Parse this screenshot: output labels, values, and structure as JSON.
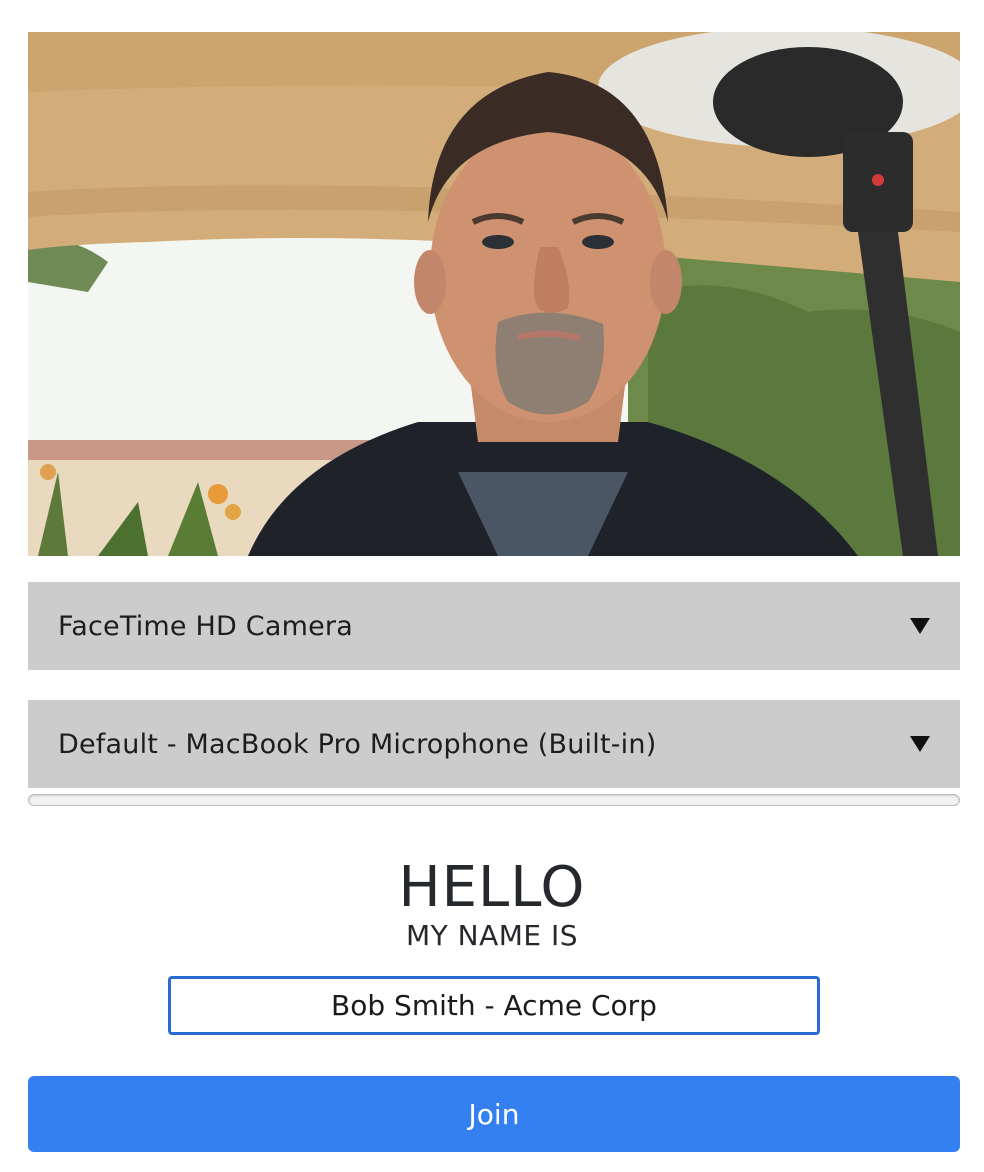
{
  "camera_select": {
    "selected": "FaceTime HD Camera"
  },
  "mic_select": {
    "selected": "Default - MacBook Pro Microphone (Built-in)"
  },
  "audio_meter": {
    "level": 0.0
  },
  "greeting": {
    "hello": "HELLO",
    "my_name_is": "MY NAME IS"
  },
  "name_field": {
    "value": "Bob Smith - Acme Corp"
  },
  "join_button": {
    "label": "Join"
  },
  "colors": {
    "select_bg": "#cccccc",
    "input_border": "#2b6cd4",
    "join_bg": "#3480f0"
  }
}
